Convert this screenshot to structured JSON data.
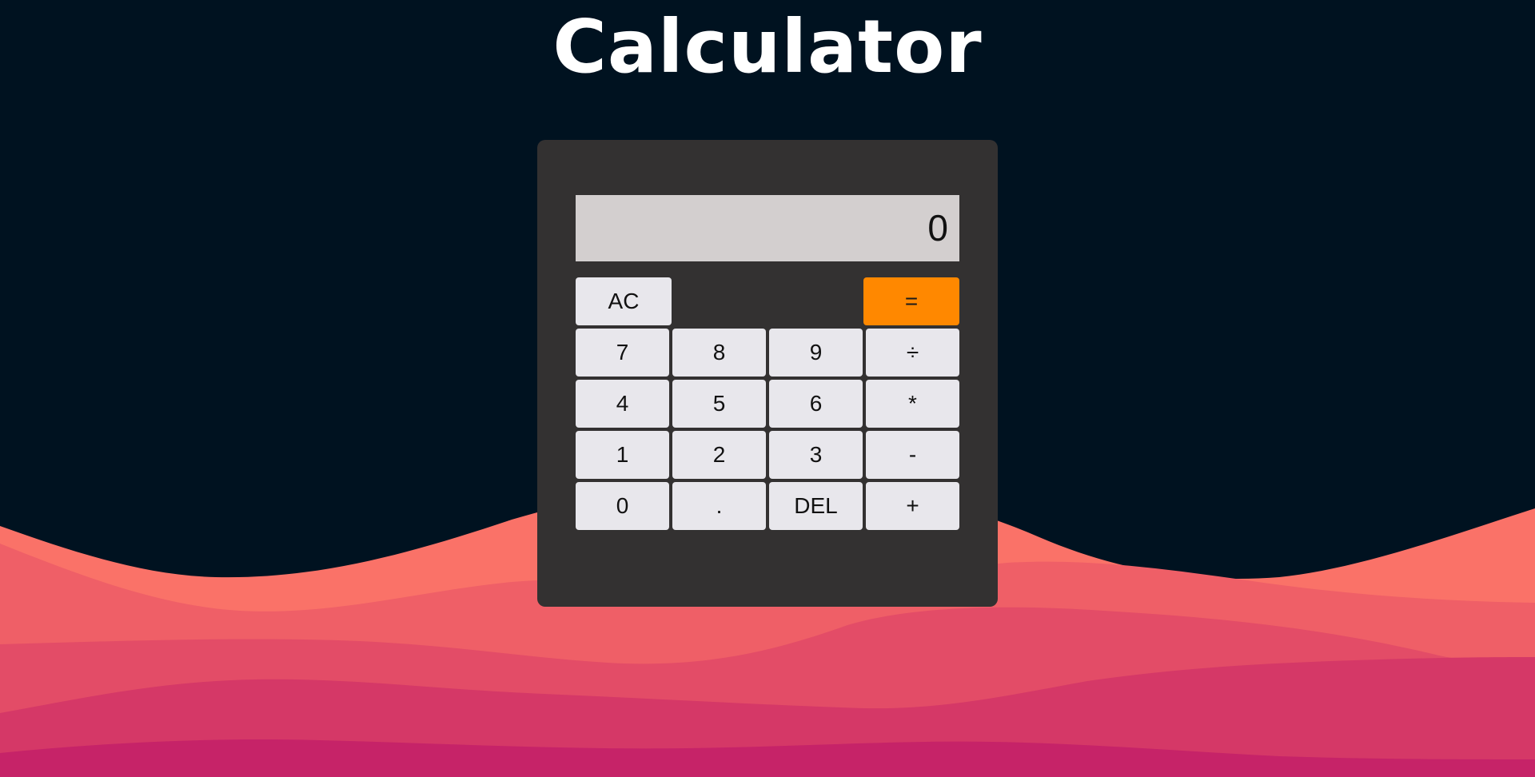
{
  "page": {
    "title": "Calculator"
  },
  "display": {
    "value": "0"
  },
  "keys": {
    "ac": "AC",
    "equals": "=",
    "seven": "7",
    "eight": "8",
    "nine": "9",
    "divide": "÷",
    "four": "4",
    "five": "5",
    "six": "6",
    "multiply": "*",
    "one": "1",
    "two": "2",
    "three": "3",
    "minus": "-",
    "zero": "0",
    "decimal": ".",
    "delete": "DEL",
    "plus": "+"
  },
  "colors": {
    "background": "#001220",
    "calculator_body": "#333131",
    "display": "#d3cfcf",
    "key": "#e8e7ec",
    "equals_key": "#ff8800",
    "wave_1": "#fa7268",
    "wave_2": "#ef5f67",
    "wave_3": "#e34c67",
    "wave_4": "#d53867",
    "wave_5": "#c62368"
  }
}
